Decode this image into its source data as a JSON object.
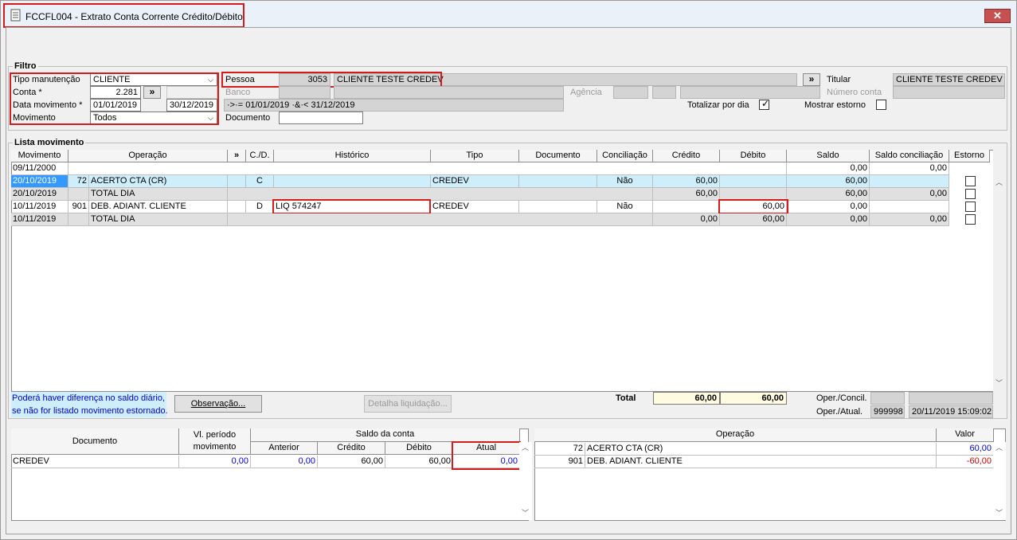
{
  "window": {
    "title": "FCCFL004 - Extrato Conta Corrente Crédito/Débito",
    "close": "✕"
  },
  "toolbar": {
    "icons": [
      "arrow-icon",
      "copy-icon",
      "printer-icon",
      "grid-icon",
      "help-icon",
      "exit-door-icon"
    ]
  },
  "filtro": {
    "title": "Filtro",
    "tipo_label": "Tipo manutenção",
    "tipo_value": "CLIENTE",
    "conta_label": "Conta *",
    "conta_value": "2.281",
    "data_label": "Data movimento *",
    "data_from": "01/01/2019",
    "data_to": "30/12/2019",
    "movimento_label": "Movimento",
    "movimento_value": "Todos",
    "pessoa_label": "Pessoa",
    "pessoa_code": "3053",
    "pessoa_name": "CLIENTE TESTE CREDEV",
    "banco_label": "Banco",
    "agencia_label": "Agência",
    "range_text": "·>·= 01/01/2019 ·&·< 31/12/2019",
    "documento_label": "Documento",
    "titular_label": "Titular",
    "titular_value": "CLIENTE TESTE CREDEV",
    "numero_conta_label": "Número conta",
    "totalizar_label": "Totalizar por dia",
    "estorno_label": "Mostrar estorno",
    "more_btn": "»"
  },
  "lista": {
    "title": "Lista movimento",
    "headers": [
      "Movimento",
      "Operação",
      "»",
      "C./D.",
      "Histórico",
      "Tipo",
      "Documento",
      "Conciliação",
      "Crédito",
      "Débito",
      "Saldo",
      "Saldo conciliação",
      "Estorno"
    ],
    "rows": [
      {
        "mov": "09/11/2000",
        "code": "",
        "op": "",
        "cd": "",
        "hist": "",
        "tipo": "",
        "doc": "",
        "conc": "",
        "cred": "",
        "deb": "",
        "saldo": "0,00",
        "saldo_conc": "0,00"
      },
      {
        "mov": "20/10/2019",
        "code": "72",
        "op": "ACERTO CTA (CR)",
        "cd": "C",
        "hist": "",
        "tipo": "CREDEV",
        "doc": "",
        "conc": "Não",
        "cred": "60,00",
        "deb": "",
        "saldo": "60,00",
        "saldo_conc": ""
      },
      {
        "mov": "20/10/2019",
        "code": "",
        "op": "TOTAL DIA",
        "cd": "",
        "hist": "",
        "tipo": "",
        "doc": "",
        "conc": "",
        "cred": "60,00",
        "deb": "",
        "saldo": "60,00",
        "saldo_conc": "0,00"
      },
      {
        "mov": "10/11/2019",
        "code": "901",
        "op": "DEB. ADIANT. CLIENTE",
        "cd": "D",
        "hist": "LIQ  574247",
        "tipo": "CREDEV",
        "doc": "",
        "conc": "Não",
        "cred": "",
        "deb": "60,00",
        "saldo": "0,00",
        "saldo_conc": ""
      },
      {
        "mov": "10/11/2019",
        "code": "",
        "op": "TOTAL DIA",
        "cd": "",
        "hist": "",
        "tipo": "",
        "doc": "",
        "conc": "",
        "cred": "0,00",
        "deb": "60,00",
        "saldo": "0,00",
        "saldo_conc": "0,00"
      }
    ]
  },
  "info": {
    "warning_line1": "Poderá haver diferença no saldo diário,",
    "warning_line2": "se não for listado movimento estornado.",
    "observacao_btn": "Observação...",
    "detalha_btn": "Detalha liquidação...",
    "total_label": "Total",
    "total_credito": "60,00",
    "total_debito": "60,00",
    "oper_concil_label": "Oper./Concil.",
    "oper_atual_label": "Oper./Atual.",
    "oper_atual_code": "999998",
    "oper_atual_date": "20/11/2019 15:09:02"
  },
  "saldo": {
    "h_documento": "Documento",
    "h_vl_periodo": "Vl. período movimento",
    "h_saldo_conta": "Saldo da conta",
    "h_anterior": "Anterior",
    "h_credito": "Crédito",
    "h_debito": "Débito",
    "h_atual": "Atual",
    "row": {
      "doc": "CREDEV",
      "vl": "0,00",
      "anterior": "0,00",
      "credito": "60,00",
      "debito": "60,00",
      "atual": "0,00"
    }
  },
  "operacoes": {
    "h_operacao": "Operação",
    "h_valor": "Valor",
    "rows": [
      {
        "code": "72",
        "name": "ACERTO CTA (CR)",
        "valor": "60,00"
      },
      {
        "code": "901",
        "name": "DEB. ADIANT. CLIENTE",
        "valor": "-60,00"
      }
    ]
  },
  "colors": {
    "blue": "#0000cc",
    "red": "#cc0000",
    "highlight": "#cfeefb",
    "selected": "#3399ff",
    "highlight_red": "#d61b1b"
  }
}
